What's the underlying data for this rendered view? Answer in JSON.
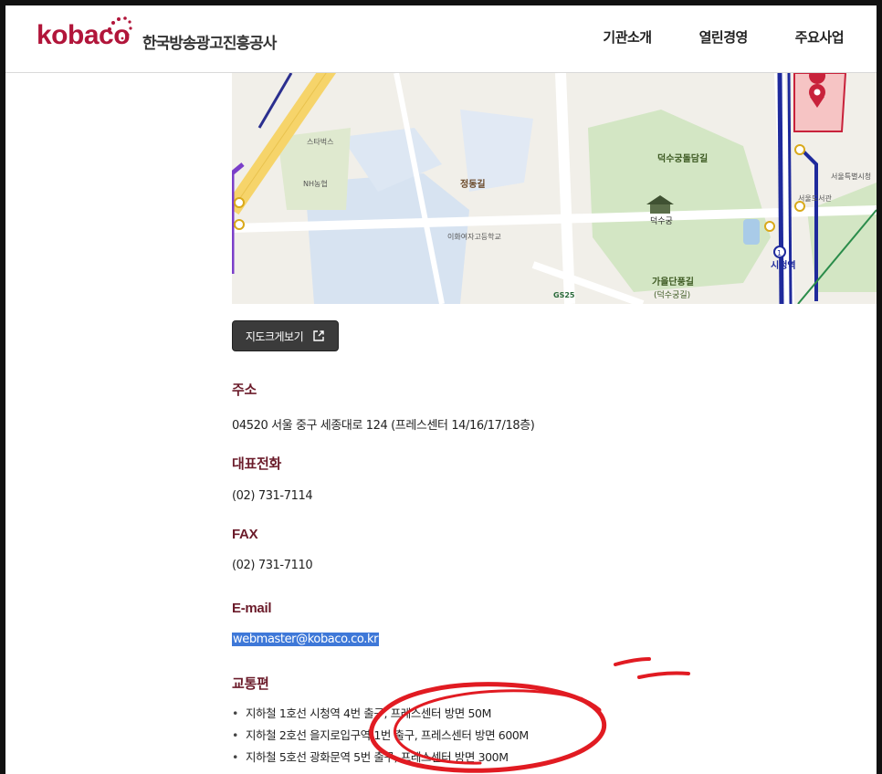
{
  "header": {
    "logo_word": "kobaco",
    "logo_korean": "한국방송광고진흥공사",
    "nav": [
      "기관소개",
      "열린경영",
      "주요사업"
    ]
  },
  "map": {
    "labels": {
      "jeongdong_gil": "정동길",
      "deoksugung_dolldam": "덕수궁돌담길",
      "deoksugung": "덕수궁",
      "gaeuldanpung": "가을단풍길",
      "gaeuldanpung_sub": "(덕수궁길)",
      "seoul_station": "시청역",
      "gs25": "GS25",
      "ewha_school": "이화여자고등학교",
      "nh": "NH농협",
      "starbucks": "스타벅스",
      "library": "서울도서관",
      "cityhall": "서울특별시청"
    }
  },
  "map_button": {
    "label": "지도크게보기"
  },
  "info": {
    "address_title": "주소",
    "address_value": "04520 서울 중구 세종대로 124 (프레스센터 14/16/17/18층)",
    "phone_title": "대표전화",
    "phone_value": "(02) 731-7114",
    "fax_title": "FAX",
    "fax_value": "(02) 731-7110",
    "email_title": "E-mail",
    "email_value": "webmaster@kobaco.co.kr",
    "transit_title": "교통편",
    "transit": [
      "지하철 1호선 시청역 4번 출구, 프레스센터 방면 50M",
      "지하철 2호선 을지로입구역 1번 출구, 프레스센터 방면 600M",
      "지하철 5호선 광화문역 5번 출구, 프레스센터 방면 300M"
    ]
  },
  "colors": {
    "brand": "#b1153a",
    "title": "#6b1b2a",
    "highlight": "#3e78d8",
    "annotation": "#e11b22"
  }
}
